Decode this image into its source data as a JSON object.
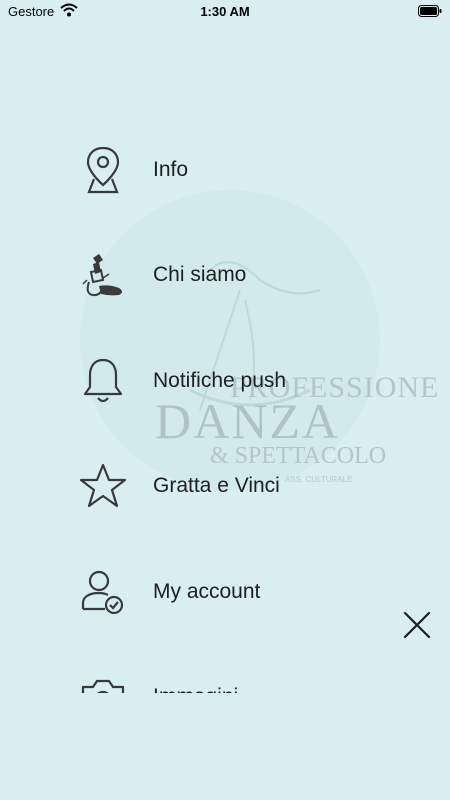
{
  "status_bar": {
    "carrier": "Gestore",
    "time": "1:30 AM"
  },
  "watermark": {
    "line1": "PROFESSIONE",
    "line2": "DANZA",
    "line3": "& SPETTACOLO",
    "line4": "ASS. CULTURALE"
  },
  "menu": {
    "items": [
      {
        "label": "Info",
        "icon": "map-pin-icon"
      },
      {
        "label": "Chi siamo",
        "icon": "ballet-shoe-icon"
      },
      {
        "label": "Notifiche push",
        "icon": "bell-icon"
      },
      {
        "label": "Gratta e Vinci",
        "icon": "star-icon"
      },
      {
        "label": "My account",
        "icon": "user-check-icon"
      },
      {
        "label": "Immagini",
        "icon": "camera-icon"
      }
    ]
  },
  "colors": {
    "background": "#d9eef1",
    "icon_stroke": "#3a3a3a"
  }
}
